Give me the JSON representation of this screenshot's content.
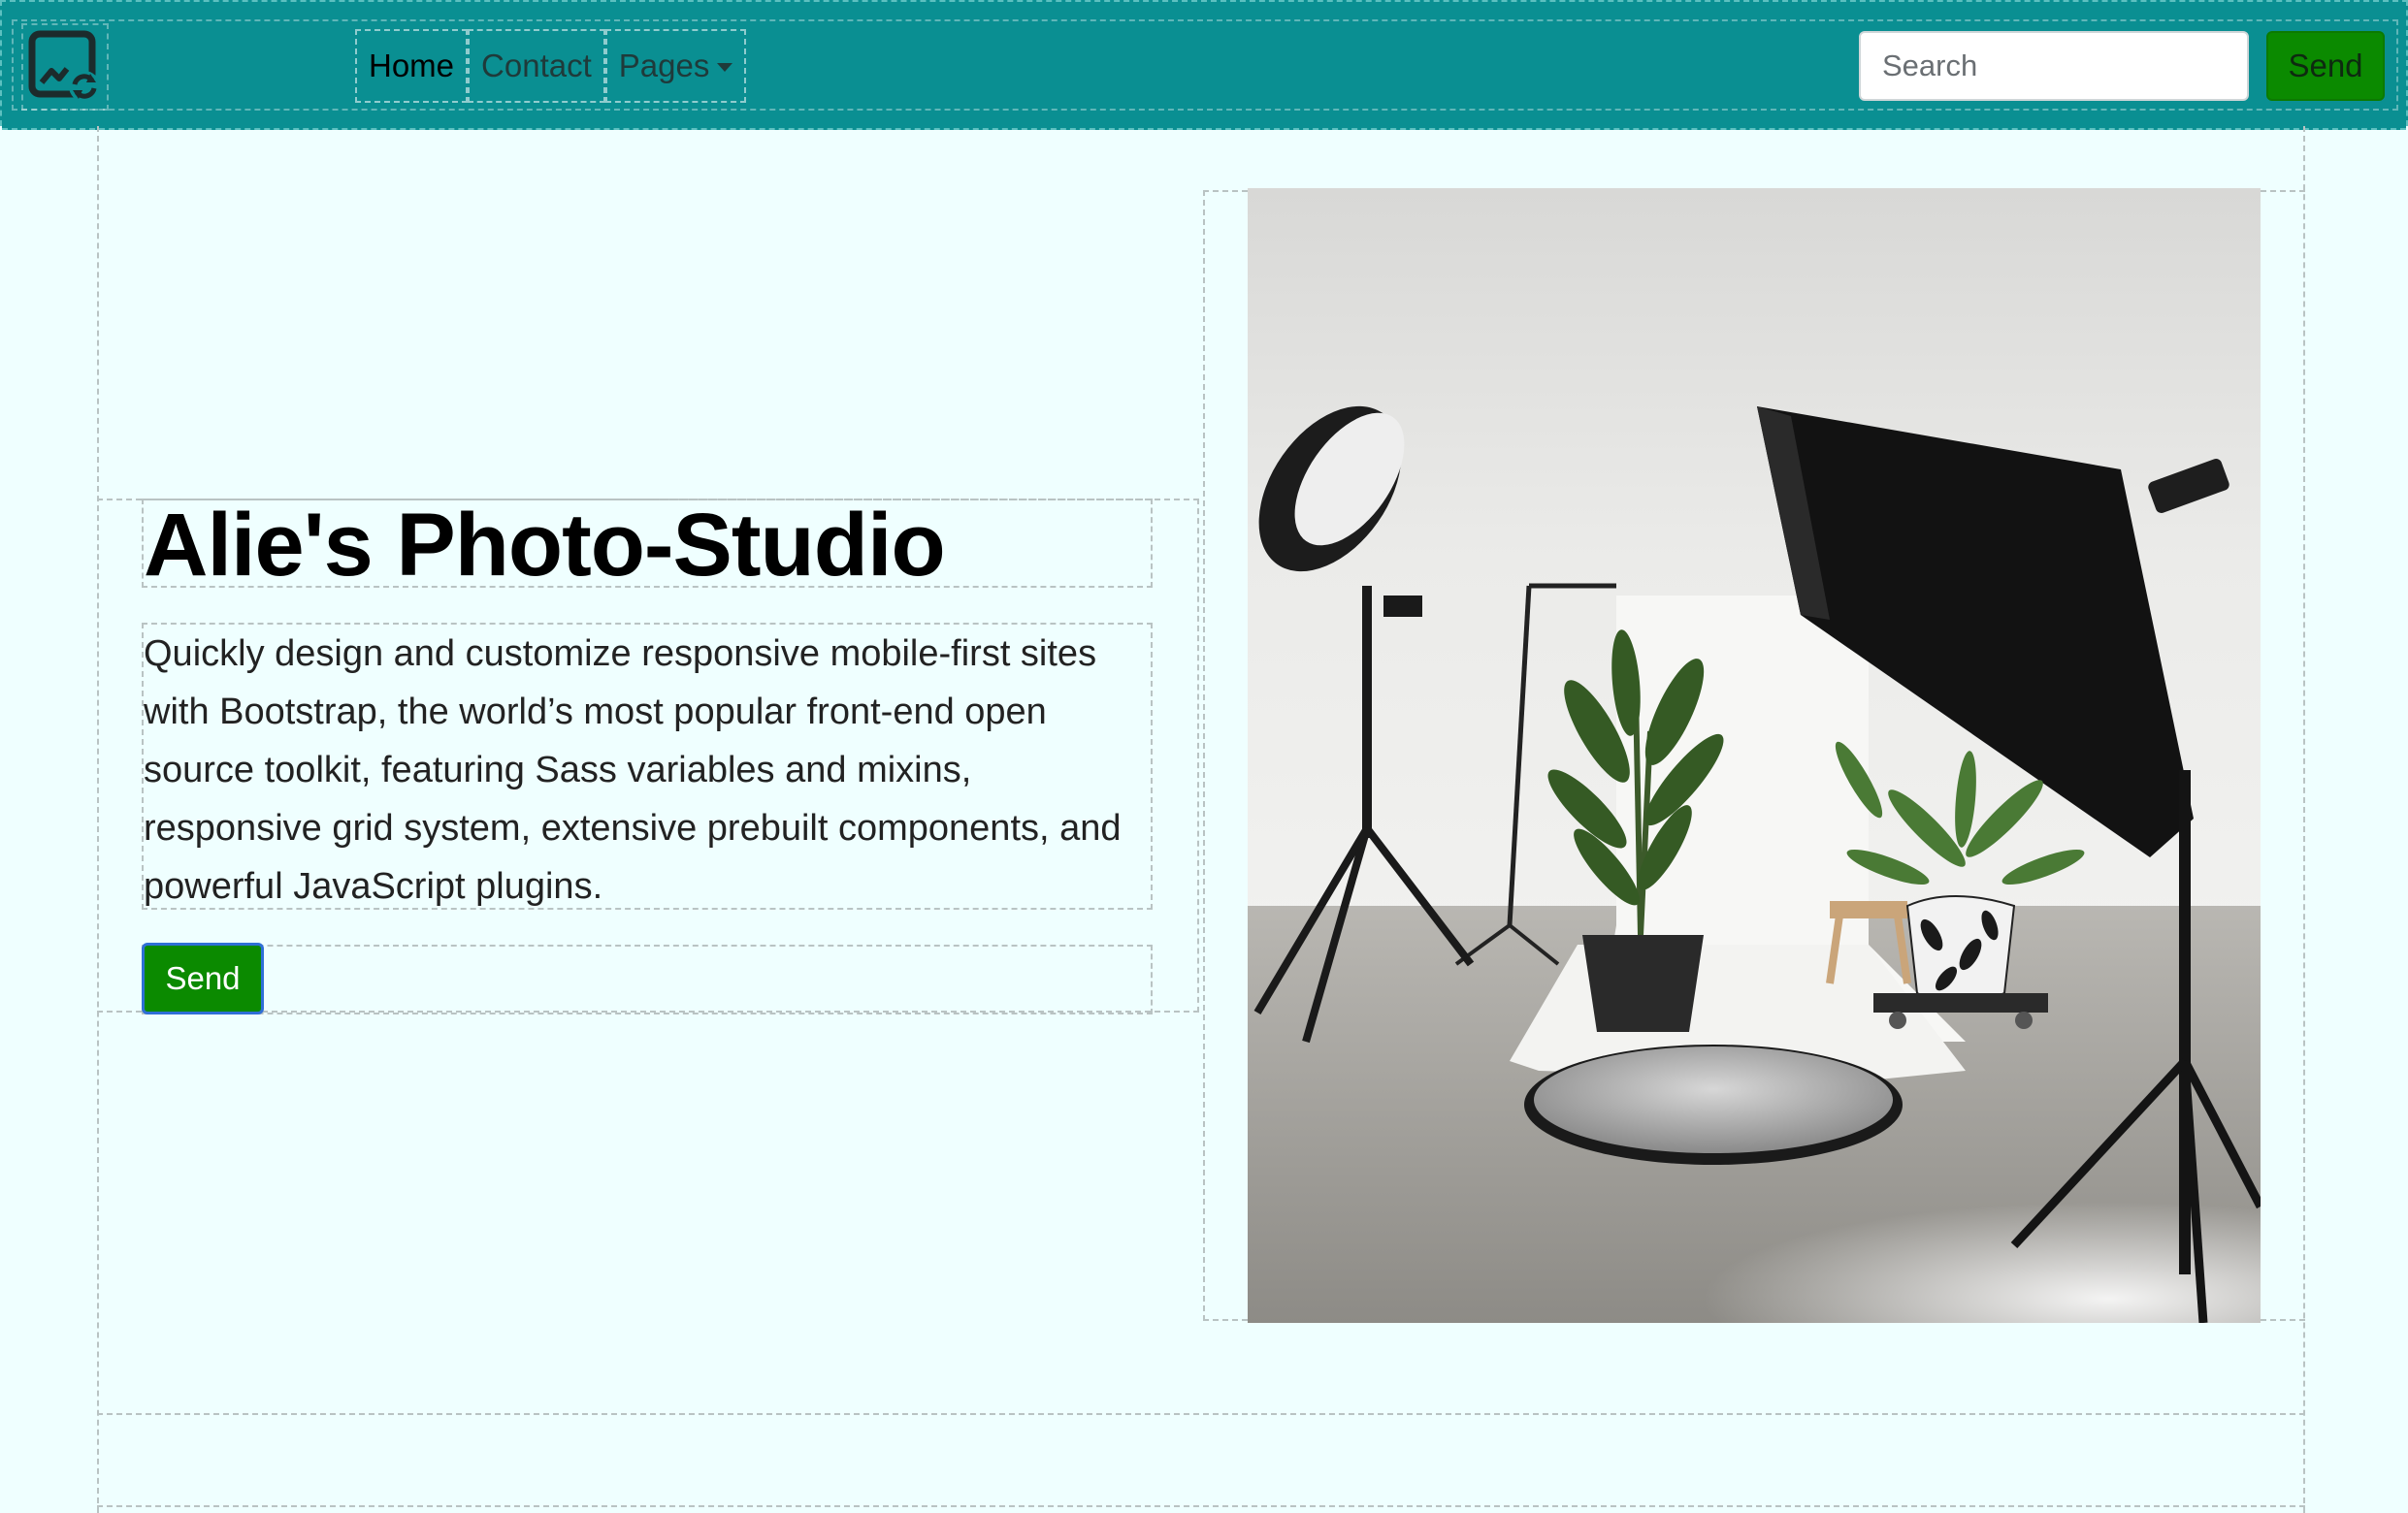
{
  "navbar": {
    "brand_icon": "image-sync-icon",
    "links": [
      {
        "label": "Home",
        "active": true
      },
      {
        "label": "Contact",
        "active": false
      },
      {
        "label": "Pages",
        "active": false,
        "dropdown": true
      }
    ],
    "search_placeholder": "Search",
    "send_label": "Send",
    "background_color": "#0a8f92",
    "send_color": "#0b8a00"
  },
  "hero": {
    "title": "Alie's Photo-Studio",
    "lead": "Quickly design and customize responsive mobile-first sites with Bootstrap, the world’s most popular front-end open source toolkit, featuring Sass variables and mixins, responsive grid system, extensive prebuilt components, and powerful JavaScript plugins.",
    "button_label": "Send",
    "image": "photo-studio-image"
  },
  "colors": {
    "page_background": "#efffff",
    "button_green": "#0b8a00"
  }
}
